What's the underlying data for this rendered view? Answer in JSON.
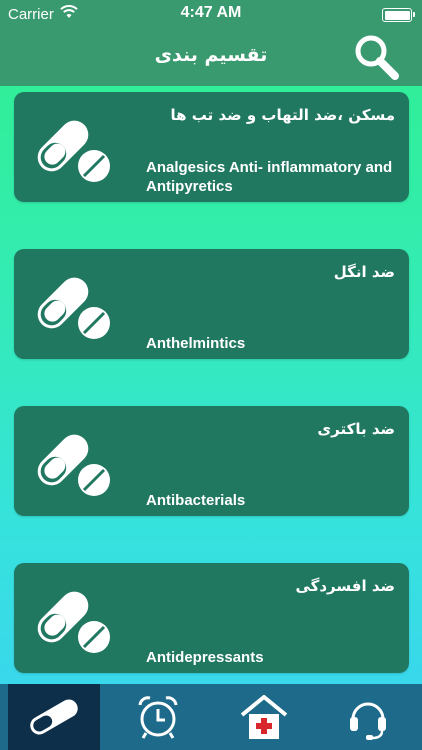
{
  "status_bar": {
    "carrier": "Carrier",
    "time": "4:47 AM"
  },
  "nav": {
    "title": "تقسیم بندی",
    "search_icon": "search-icon"
  },
  "categories": [
    {
      "fa": "مسکن ،ضد التهاب و ضد تب ها",
      "en": "Analgesics Anti- inflammatory and Antipyretics"
    },
    {
      "fa": "ضد انگل",
      "en": "Anthelmintics"
    },
    {
      "fa": "ضد باکتری",
      "en": "Antibacterials"
    },
    {
      "fa": "ضد افسردگی",
      "en": "Antidepressants"
    }
  ],
  "tabs": [
    {
      "icon": "pill-icon",
      "active": true
    },
    {
      "icon": "alarm-clock-icon",
      "active": false
    },
    {
      "icon": "hospital-icon",
      "active": false
    },
    {
      "icon": "headset-icon",
      "active": false
    }
  ],
  "colors": {
    "header": "#3a9a6f",
    "card": "#217861",
    "tab_bar": "#1d6a8a",
    "tab_active": "#0d2f4a",
    "gradient_top": "#2ff08e",
    "gradient_bottom": "#3ad3f2"
  }
}
